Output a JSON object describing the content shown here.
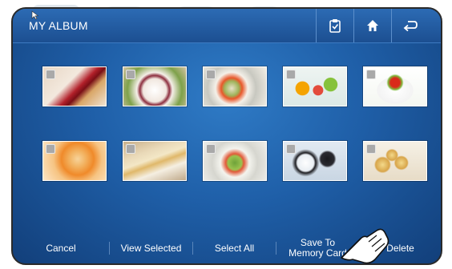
{
  "topbar": {
    "title": "MY ALBUM",
    "buttons": [
      {
        "name": "clipboard-icon"
      },
      {
        "name": "home-icon"
      },
      {
        "name": "back-icon"
      }
    ]
  },
  "photos": [
    {
      "name": "photo-cheesecake",
      "checked": false
    },
    {
      "name": "photo-dessert-plate",
      "checked": false
    },
    {
      "name": "photo-salad-plate",
      "checked": false
    },
    {
      "name": "photo-fruit",
      "checked": false
    },
    {
      "name": "photo-tomato-bowl",
      "checked": false
    },
    {
      "name": "photo-ice-cream",
      "checked": false
    },
    {
      "name": "photo-quiche",
      "checked": false
    },
    {
      "name": "photo-green-salad",
      "checked": false
    },
    {
      "name": "photo-cookies",
      "checked": false
    },
    {
      "name": "photo-tartlets",
      "checked": false
    }
  ],
  "bottombar": {
    "cancel": "Cancel",
    "view_selected": "View Selected",
    "select_all": "Select All",
    "save_to_line1": "Save To",
    "save_to_line2": "Memory Card",
    "delete": "Delete"
  },
  "colors": {
    "background_top": "#2f7bc6",
    "background_bottom": "#123f7a",
    "topbar": "#1c4f91",
    "checkbox": "#a9a9a9"
  }
}
